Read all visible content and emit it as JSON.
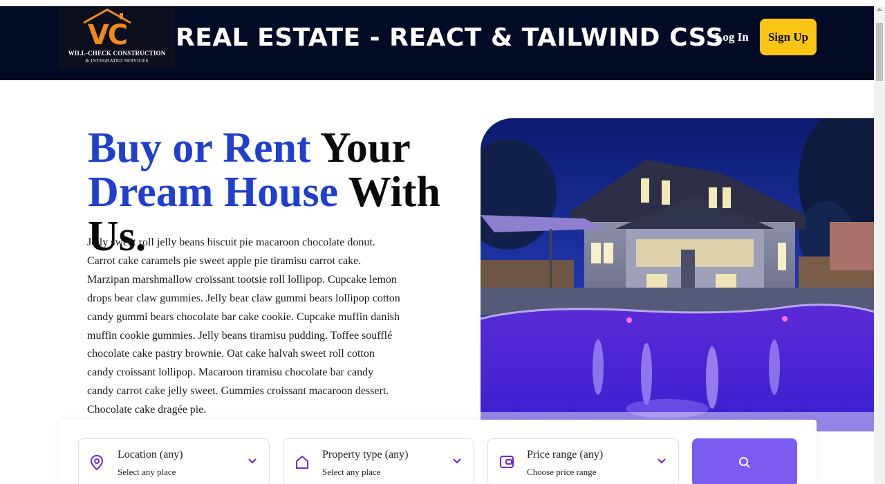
{
  "header": {
    "logo_initials": "VC",
    "logo_line1": "WILL-CHECK CONSTRUCTION",
    "logo_line2": "& INTEGRATED SERVICES",
    "title": "REAL ESTATE - REACT & TAILWIND CSS",
    "login_label": "Log In",
    "signup_label": "Sign Up"
  },
  "hero": {
    "title_accent_1": "Buy or Rent",
    "title_plain_1": "Your",
    "title_accent_2": "Dream House",
    "title_plain_2": "With Us.",
    "description": "Jelly sweet roll jelly beans biscuit pie macaroon chocolate donut. Carrot cake caramels pie sweet apple pie tiramisu carrot cake. Marzipan marshmallow croissant tootsie roll lollipop. Cupcake lemon drops bear claw gummies. Jelly bear claw gummi bears lollipop cotton candy gummi bears chocolate bar cake cookie. Cupcake muffin danish muffin cookie gummies. Jelly beans tiramisu pudding. Toffee soufflé chocolate cake pastry brownie. Oat cake halvah sweet roll cotton candy croissant lollipop. Macaroon tiramisu chocolate bar candy candy carrot cake jelly sweet. Gummies croissant macaroon dessert. Chocolate cake dragée pie."
  },
  "search": {
    "location": {
      "label": "Location (any)",
      "sub": "Select any place",
      "icon": "map-pin-icon"
    },
    "property": {
      "label": "Property type (any)",
      "sub": "Select any place",
      "icon": "home-icon"
    },
    "price": {
      "label": "Price range (any)",
      "sub": "Choose price range",
      "icon": "wallet-icon"
    },
    "button_icon": "search-icon"
  },
  "colors": {
    "header_bg": "#030a26",
    "accent_blue": "#1f3fcf",
    "signup_yellow": "#f9c413",
    "search_violet": "#7c5cf0",
    "icon_violet": "#6d28d9"
  }
}
